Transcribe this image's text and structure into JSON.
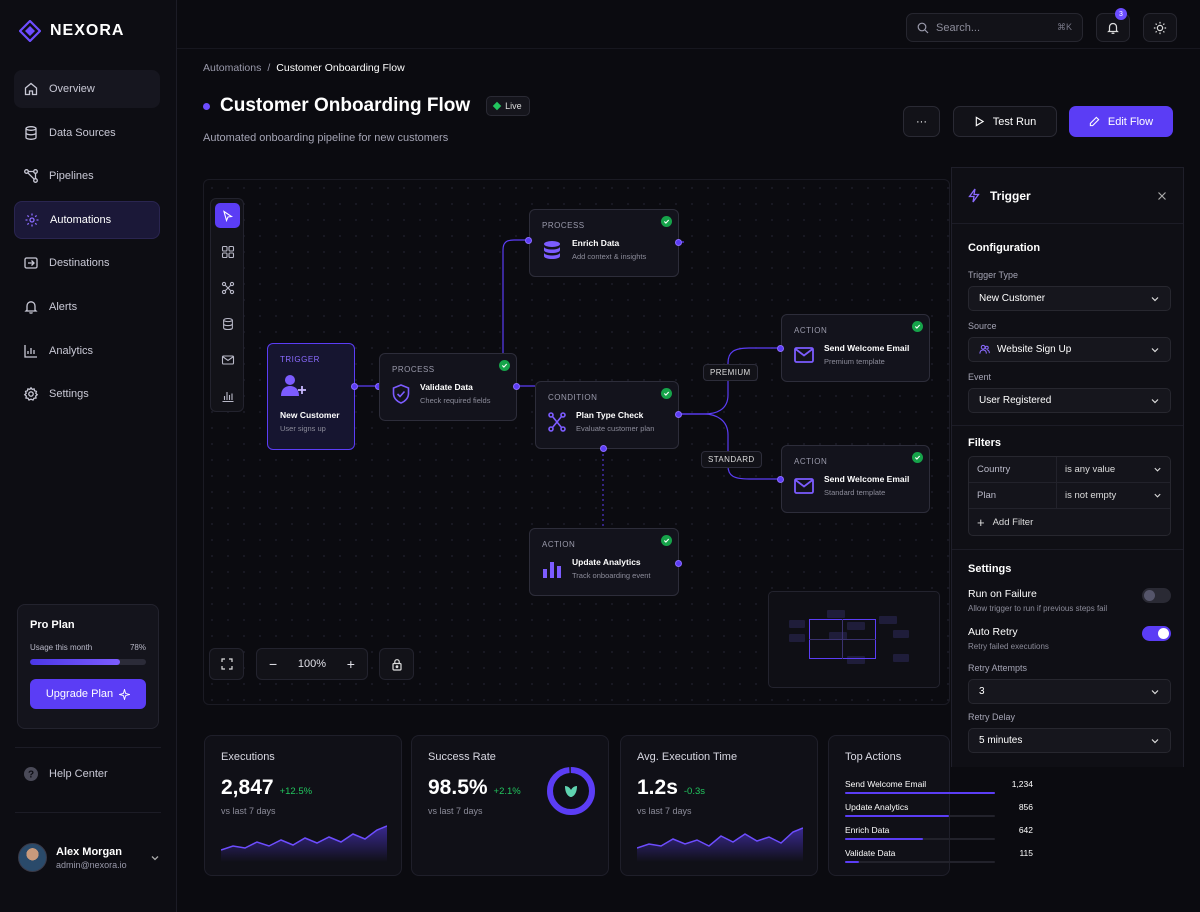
{
  "app": {
    "name": "NEXORA"
  },
  "sidebar": {
    "items": [
      {
        "label": "Overview",
        "icon": "home-icon"
      },
      {
        "label": "Data Sources",
        "icon": "database-icon"
      },
      {
        "label": "Pipelines",
        "icon": "pipeline-icon"
      },
      {
        "label": "Automations",
        "icon": "automation-icon",
        "active": true
      },
      {
        "label": "Destinations",
        "icon": "destination-icon"
      },
      {
        "label": "Alerts",
        "icon": "bell-icon"
      },
      {
        "label": "Analytics",
        "icon": "chart-icon"
      },
      {
        "label": "Settings",
        "icon": "gear-icon"
      }
    ],
    "plan": {
      "title": "Pro Plan",
      "usage_label": "Usage this month",
      "usage_value": "78%",
      "usage_fraction": 0.78,
      "button": "Upgrade Plan"
    },
    "help": "Help Center",
    "user": {
      "name": "Alex Morgan",
      "email": "admin@nexora.io"
    }
  },
  "topbar": {
    "search_placeholder": "Search...",
    "shortcut": "⌘K",
    "notification_count": "3"
  },
  "breadcrumb": {
    "parent": "Automations",
    "separator": "/",
    "current": "Customer Onboarding Flow"
  },
  "page": {
    "title": "Customer Onboarding Flow",
    "status": "Live",
    "subtitle": "Automated onboarding pipeline for new customers",
    "more": "···",
    "test_run": "Test Run",
    "edit_flow": "Edit Flow"
  },
  "flow": {
    "nodes": {
      "trigger": {
        "type": "TRIGGER",
        "title": "New Customer",
        "desc": "User signs up"
      },
      "validate": {
        "type": "PROCESS",
        "title": "Validate Data",
        "desc": "Check required fields"
      },
      "enrich": {
        "type": "PROCESS",
        "title": "Enrich Data",
        "desc": "Add context & insights"
      },
      "condition": {
        "type": "CONDITION",
        "title": "Plan Type Check",
        "desc": "Evaluate customer plan"
      },
      "premium": {
        "type": "ACTION",
        "title": "Send Welcome Email",
        "desc": "Premium template"
      },
      "standard": {
        "type": "ACTION",
        "title": "Send Welcome Email",
        "desc": "Standard template"
      },
      "analytics": {
        "type": "ACTION",
        "title": "Update Analytics",
        "desc": "Track onboarding event"
      }
    },
    "edge_labels": {
      "premium": "PREMIUM",
      "standard": "STANDARD"
    },
    "zoom": "100%"
  },
  "panel": {
    "title": "Trigger",
    "configuration": "Configuration",
    "trigger_type_label": "Trigger Type",
    "trigger_type": "New Customer",
    "source_label": "Source",
    "source": "Website Sign Up",
    "event_label": "Event",
    "event": "User Registered",
    "filters_title": "Filters",
    "filters": [
      {
        "field": "Country",
        "op": "is any value"
      },
      {
        "field": "Plan",
        "op": "is not empty"
      }
    ],
    "add_filter": "Add Filter",
    "settings_title": "Settings",
    "run_on_failure": {
      "label": "Run on Failure",
      "desc": "Allow trigger to run if previous steps fail",
      "on": false
    },
    "auto_retry": {
      "label": "Auto Retry",
      "desc": "Retry failed executions",
      "on": true
    },
    "retry_attempts_label": "Retry Attempts",
    "retry_attempts": "3",
    "retry_delay_label": "Retry Delay",
    "retry_delay": "5 minutes"
  },
  "stats": {
    "executions": {
      "label": "Executions",
      "value": "2,847",
      "delta": "+12.5%",
      "sub": "vs last 7 days"
    },
    "success": {
      "label": "Success Rate",
      "value": "98.5%",
      "delta": "+2.1%",
      "sub": "vs last 7 days",
      "fraction": 0.985
    },
    "avg_time": {
      "label": "Avg. Execution Time",
      "value": "1.2s",
      "delta": "-0.3s",
      "sub": "vs last 7 days"
    },
    "top_actions": {
      "label": "Top Actions",
      "items": [
        {
          "name": "Send Welcome Email",
          "count": "1,234",
          "value": 1234
        },
        {
          "name": "Update Analytics",
          "count": "856",
          "value": 856
        },
        {
          "name": "Enrich Data",
          "count": "642",
          "value": 642
        },
        {
          "name": "Validate Data",
          "count": "115",
          "value": 115
        }
      ]
    }
  },
  "colors": {
    "accent": "#5b3df5",
    "success": "#22c55e",
    "background": "#0b0b10"
  }
}
